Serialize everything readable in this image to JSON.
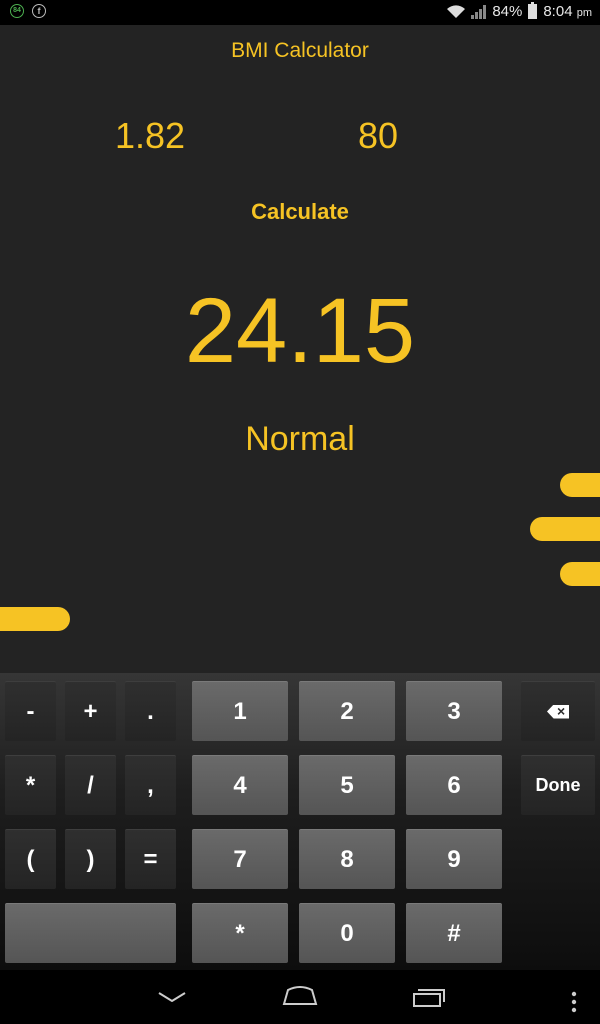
{
  "status_bar": {
    "notif_icons": [
      "84",
      "f"
    ],
    "battery_percent": "84%",
    "time": "8:04",
    "ampm": "pm"
  },
  "app": {
    "title": "BMI Calculator",
    "height_value": "1.82",
    "weight_value": "80",
    "calculate_label": "Calculate",
    "bmi_result": "24.15",
    "category": "Normal",
    "accent_color": "#f6c324"
  },
  "keyboard": {
    "rows": [
      [
        "-",
        "+",
        ".",
        "1",
        "2",
        "3",
        "backspace"
      ],
      [
        "*",
        "/",
        ",",
        "4",
        "5",
        "6",
        "Done"
      ],
      [
        "(",
        ")",
        "=",
        "7",
        "8",
        "9"
      ],
      [
        "space",
        "*",
        "0",
        "#"
      ]
    ],
    "done_label": "Done"
  },
  "navbar": {
    "icons": [
      "back-icon",
      "home-icon",
      "recent-apps-icon",
      "menu-icon"
    ]
  }
}
